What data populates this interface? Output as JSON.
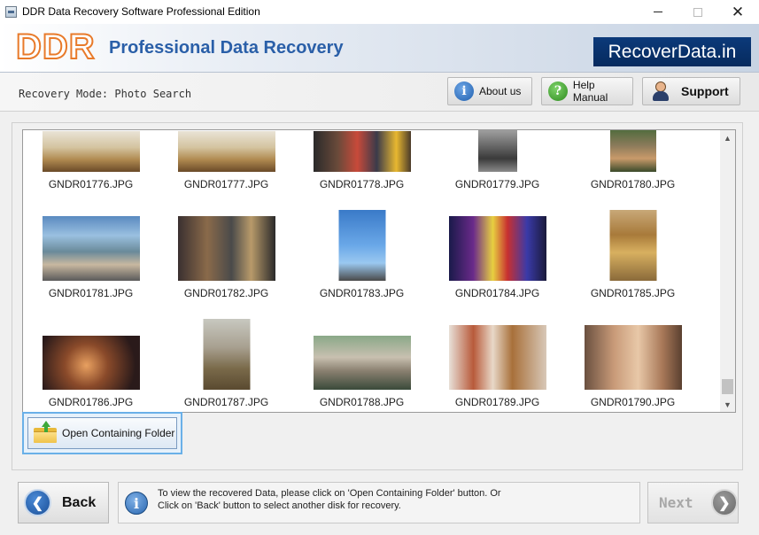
{
  "window": {
    "title": "DDR Data Recovery Software Professional Edition",
    "minimize_glyph": "",
    "close_glyph": "✕"
  },
  "banner": {
    "logo": "DDR",
    "title": "Professional Data Recovery",
    "brand": "RecoverData.in",
    "logo_color": "#e87a2a",
    "title_color": "#2a5fa8",
    "brand_bg": "#0c3a7a"
  },
  "toolbar": {
    "mode_label": "Recovery Mode: Photo Search",
    "about_label": "About us",
    "help_label": "Help Manual",
    "support_label": "Support",
    "about_icon": "i",
    "help_icon": "?"
  },
  "gallery": {
    "files": [
      {
        "name": "GNDR01776.JPG",
        "scene": "cafe"
      },
      {
        "name": "GNDR01777.JPG",
        "scene": "cafe"
      },
      {
        "name": "GNDR01778.JPG",
        "scene": "friends-group"
      },
      {
        "name": "GNDR01779.JPG",
        "scene": "street-group"
      },
      {
        "name": "GNDR01780.JPG",
        "scene": "couple-outdoor"
      },
      {
        "name": "GNDR01781.JPG",
        "scene": "friends-sitting"
      },
      {
        "name": "GNDR01782.JPG",
        "scene": "street-musicians"
      },
      {
        "name": "GNDR01783.JPG",
        "scene": "sky-group"
      },
      {
        "name": "GNDR01784.JPG",
        "scene": "party-lights"
      },
      {
        "name": "GNDR01785.JPG",
        "scene": "autumn-woman"
      },
      {
        "name": "GNDR01786.JPG",
        "scene": "night-lights"
      },
      {
        "name": "GNDR01787.JPG",
        "scene": "field-couple"
      },
      {
        "name": "GNDR01788.JPG",
        "scene": "rocks-couple"
      },
      {
        "name": "GNDR01789.JPG",
        "scene": "women-laughing"
      },
      {
        "name": "GNDR01790.JPG",
        "scene": "family-room"
      }
    ],
    "scroll_up_glyph": "▲",
    "scroll_down_glyph": "▼"
  },
  "actions": {
    "open_folder_label": "Open Containing Folder"
  },
  "footer": {
    "back_label": "Back",
    "next_label": "Next",
    "back_glyph": "❮",
    "next_glyph": "❯",
    "info_icon": "i",
    "info_line1": "To view the recovered Data, please click on 'Open Containing Folder' button. Or",
    "info_line2": "Click on 'Back' button to select another disk for recovery."
  }
}
